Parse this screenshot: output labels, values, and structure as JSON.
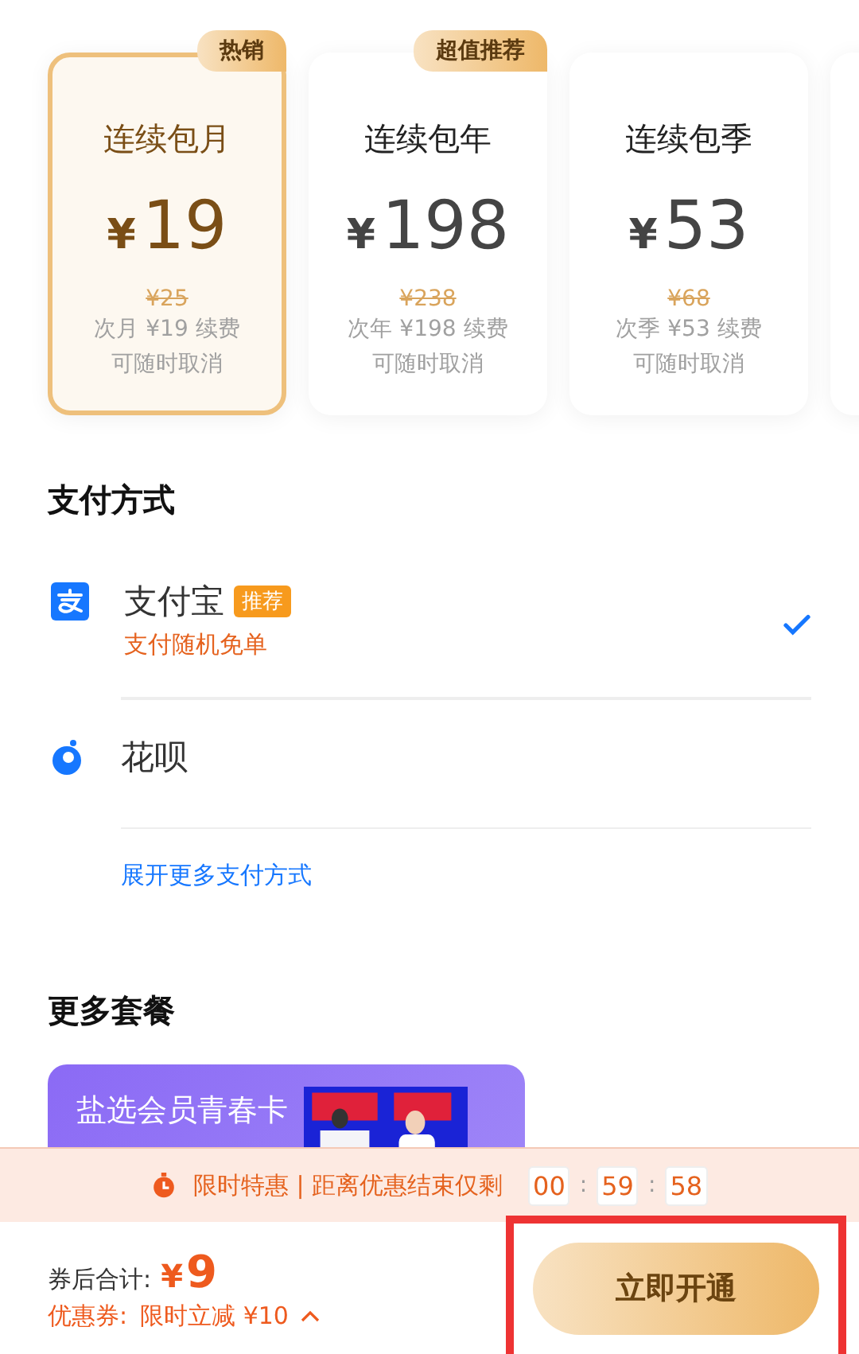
{
  "plans": [
    {
      "name": "连续包月",
      "price": "19",
      "currency": "¥",
      "original_price": "¥25",
      "renewal": "次月 ¥19 续费",
      "note": "可随时取消",
      "badge": "热销",
      "selected": true
    },
    {
      "name": "连续包年",
      "price": "198",
      "currency": "¥",
      "original_price": "¥238",
      "renewal": "次年 ¥198 续费",
      "note": "可随时取消",
      "badge": "超值推荐",
      "selected": false
    },
    {
      "name": "连续包季",
      "price": "53",
      "currency": "¥",
      "original_price": "¥68",
      "renewal": "次季 ¥53 续费",
      "note": "可随时取消",
      "selected": false
    }
  ],
  "payment": {
    "title": "支付方式",
    "methods": [
      {
        "kind": "alipay",
        "name": "支付宝",
        "tag": "推荐",
        "subtitle": "支付随机免单",
        "selected": true
      },
      {
        "kind": "huabei",
        "name": "花呗",
        "selected": false
      }
    ],
    "more_link": "展开更多支付方式"
  },
  "more_packages": {
    "title": "更多套餐",
    "cards": [
      {
        "title": "盐选会员青春卡",
        "kind": "picture"
      }
    ]
  },
  "countdown": {
    "label": "限时特惠 | 距离优惠结束仅剩",
    "hours": "00",
    "minutes": "59",
    "seconds": "58",
    "separator": ":"
  },
  "footer": {
    "total_label": "券后合计:",
    "total_currency": "¥",
    "total_value": "9",
    "coupon_label": "优惠券:",
    "coupon_value": "限时立减 ¥10",
    "button": "立即开通",
    "highlighted": true
  }
}
